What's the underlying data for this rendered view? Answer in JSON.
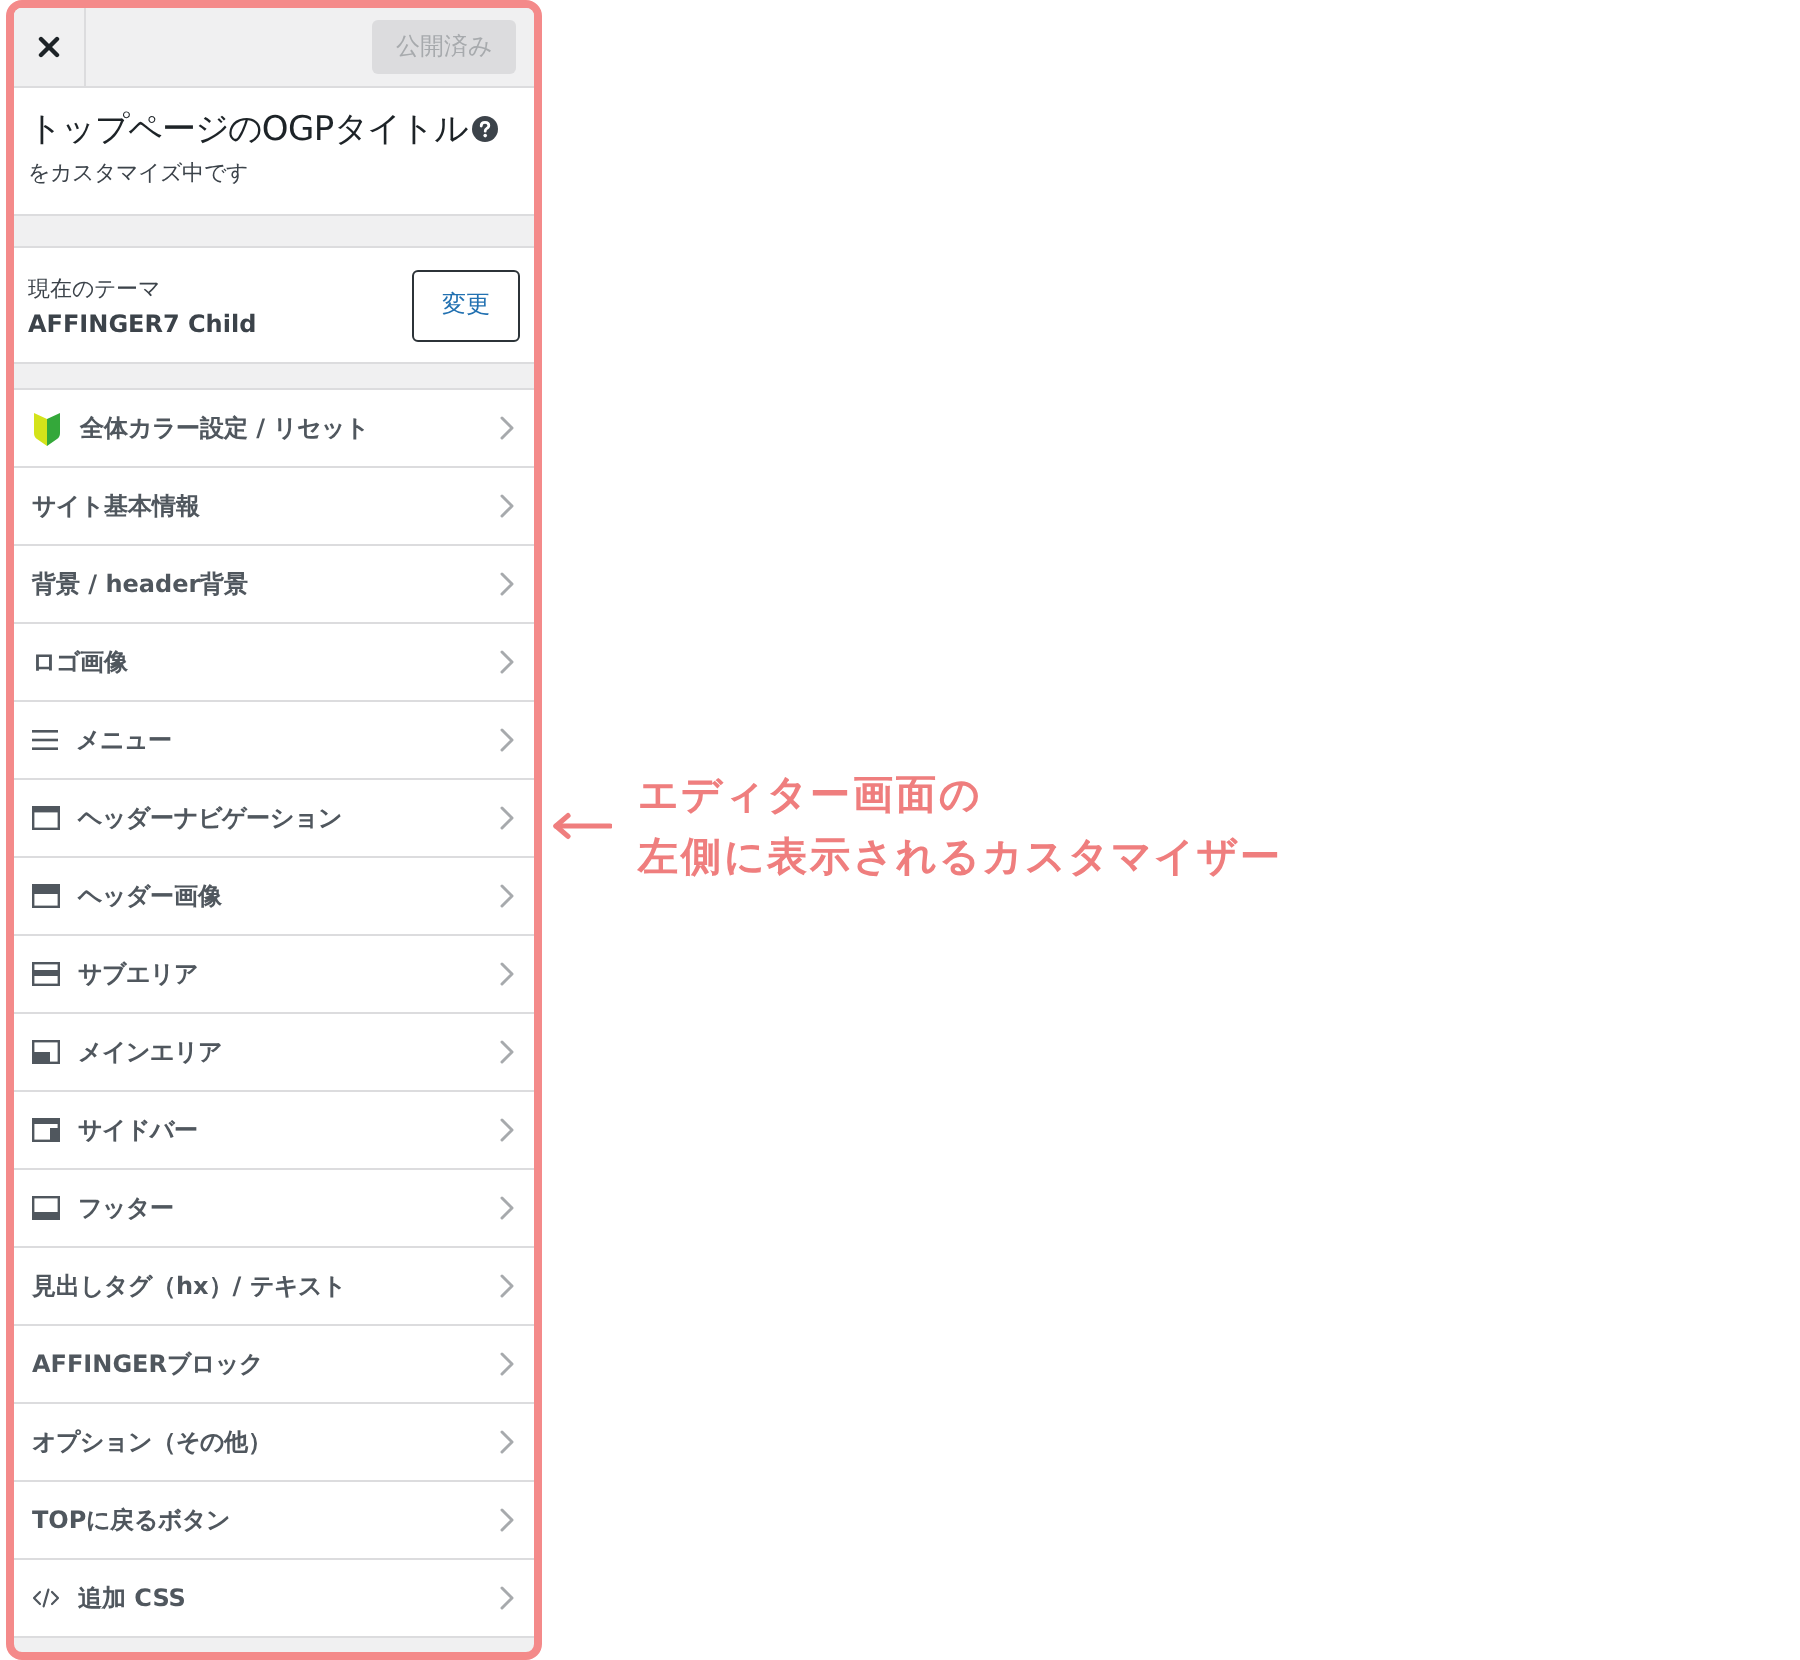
{
  "header": {
    "publish_button": {
      "label": "公開済み",
      "disabled": true
    }
  },
  "preview": {
    "title": "トップページのOGPタイトル",
    "subtitle": "をカスタマイズ中です"
  },
  "theme": {
    "caption": "現在のテーマ",
    "name": "AFFINGER7 Child",
    "change_button": "変更"
  },
  "sections": [
    {
      "label": "全体カラー設定 / リセット",
      "kind": "leaf"
    },
    {
      "label": "サイト基本情報",
      "kind": "plain"
    },
    {
      "label": "背景 / header背景",
      "kind": "plain"
    },
    {
      "label": "ロゴ画像",
      "kind": "plain"
    },
    {
      "label": "メニュー",
      "kind": "menu"
    },
    {
      "label": "ヘッダーナビゲーション",
      "kind": "navbar"
    },
    {
      "label": "ヘッダー画像",
      "kind": "header"
    },
    {
      "label": "サブエリア",
      "kind": "subarea"
    },
    {
      "label": "メインエリア",
      "kind": "main"
    },
    {
      "label": "サイドバー",
      "kind": "sidebar"
    },
    {
      "label": "フッター",
      "kind": "footer"
    },
    {
      "label": "見出しタグ（hx）/ テキスト",
      "kind": "plain"
    },
    {
      "label": "AFFINGERブロック",
      "kind": "plain"
    },
    {
      "label": "オプション（その他）",
      "kind": "plain"
    },
    {
      "label": "TOPに戻るボタン",
      "kind": "plain"
    },
    {
      "label": "追加 CSS",
      "kind": "code"
    }
  ],
  "annotation": {
    "lines": [
      "エディター画面の",
      "左側に表示されるカスタマイザー"
    ]
  }
}
